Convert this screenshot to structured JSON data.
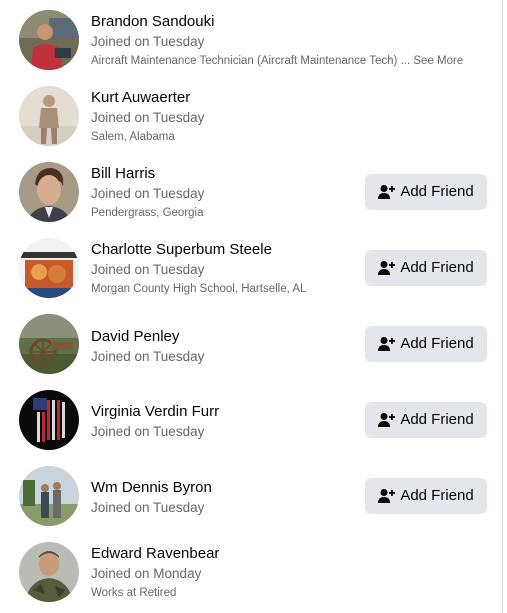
{
  "members": [
    {
      "name": "Brandon Sandouki",
      "joined": "Joined on Tuesday",
      "detail": "Aircraft Maintenance Technician (Aircraft Maintenance Tech) ...",
      "see_more": "See More",
      "show_add_friend": false
    },
    {
      "name": "Kurt Auwaerter",
      "joined": "Joined on Tuesday",
      "detail": "Salem, Alabama",
      "show_add_friend": false
    },
    {
      "name": "Bill Harris",
      "joined": "Joined on Tuesday",
      "detail": "Pendergrass, Georgia",
      "show_add_friend": true
    },
    {
      "name": "Charlotte Superbum Steele",
      "joined": "Joined on Tuesday",
      "detail": "Morgan County High School, Hartselle, AL",
      "show_add_friend": true
    },
    {
      "name": "David Penley",
      "joined": "Joined on Tuesday",
      "show_add_friend": true
    },
    {
      "name": "Virginia Verdin Furr",
      "joined": "Joined on Tuesday",
      "show_add_friend": true
    },
    {
      "name": "Wm Dennis Byron",
      "joined": "Joined on Tuesday",
      "show_add_friend": true
    },
    {
      "name": "Edward Ravenbear",
      "joined": "Joined on Monday",
      "detail": "Works at Retired",
      "show_add_friend": false
    }
  ],
  "add_friend_label": "Add Friend",
  "add_friend_icon": "add-friend-icon",
  "colors": {
    "button_bg": "#e4e6eb",
    "secondary_text": "#65676b",
    "primary_text": "#050505"
  }
}
